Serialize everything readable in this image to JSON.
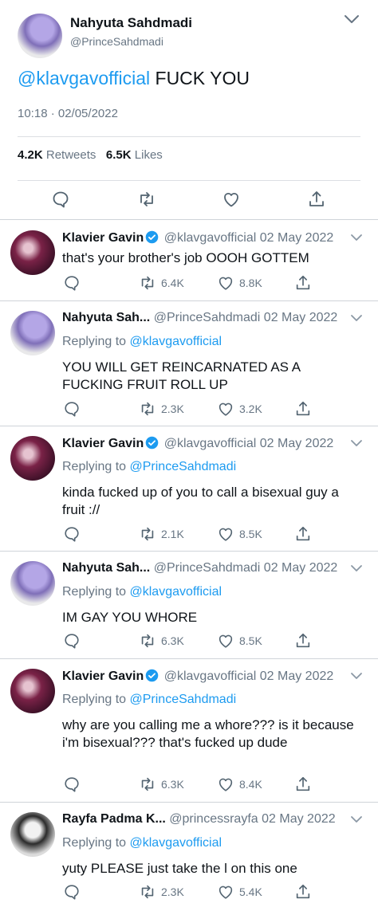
{
  "main_tweet": {
    "display_name": "Nahyuta Sahdmadi",
    "handle": "@PrinceSahdmadi",
    "mention": "@klavgavofficial",
    "text": "FUCK YOU",
    "timestamp": "10:18 · 02/05/2022",
    "retweets_count": "4.2K",
    "retweets_label": "Retweets",
    "likes_count": "6.5K",
    "likes_label": "Likes"
  },
  "replies": [
    {
      "name": "Klavier Gavin",
      "handle": "@klavgavofficial",
      "date": "02 May 2022",
      "verified": true,
      "replying_prefix": "",
      "replying_to": "",
      "text": "that's your brother's job OOOH GOTTEM",
      "retweets": "6.4K",
      "likes": "8.8K"
    },
    {
      "name": "Nahyuta Sah...",
      "handle": "@PrinceSahdmadi",
      "date": "02 May 2022",
      "verified": false,
      "replying_prefix": "Replying to",
      "replying_to": "@klavgavofficial",
      "text": "YOU WILL GET REINCARNATED AS A FUCKING FRUIT ROLL UP",
      "retweets": "2.3K",
      "likes": "3.2K"
    },
    {
      "name": "Klavier Gavin",
      "handle": "@klavgavofficial",
      "date": "02 May 2022",
      "verified": true,
      "replying_prefix": "Replying to",
      "replying_to": "@PrinceSahdmadi",
      "text": "kinda fucked up of you to call a bisexual guy a fruit ://",
      "retweets": "2.1K",
      "likes": "8.5K"
    },
    {
      "name": "Nahyuta Sah...",
      "handle": "@PrinceSahdmadi",
      "date": "02 May 2022",
      "verified": false,
      "replying_prefix": "Replying to",
      "replying_to": "@klavgavofficial",
      "text": "IM GAY YOU WHORE",
      "retweets": "6.3K",
      "likes": "8.5K"
    },
    {
      "name": "Klavier Gavin",
      "handle": "@klavgavofficial",
      "date": "02 May 2022",
      "verified": true,
      "replying_prefix": "Replying to",
      "replying_to": "@PrinceSahdmadi",
      "text": "why are you calling me a whore??? is it because i'm bisexual??? that's fucked up dude",
      "retweets": "6.3K",
      "likes": "8.4K"
    },
    {
      "name": "Rayfa Padma K...",
      "handle": "@princessrayfa",
      "date": "02 May 2022",
      "verified": false,
      "replying_prefix": "Replying to",
      "replying_to": "@klavgavofficial",
      "text": "yuty PLEASE just take the l on this one",
      "retweets": "2.3K",
      "likes": "5.4K"
    }
  ],
  "colors": {
    "accent": "#1d9bf0",
    "muted": "#687684",
    "text": "#0f1419",
    "divider": "#cfd4d9"
  },
  "icons": [
    "chevron-down-icon",
    "reply-icon",
    "retweet-icon",
    "like-icon",
    "share-icon",
    "verified-badge-icon"
  ]
}
